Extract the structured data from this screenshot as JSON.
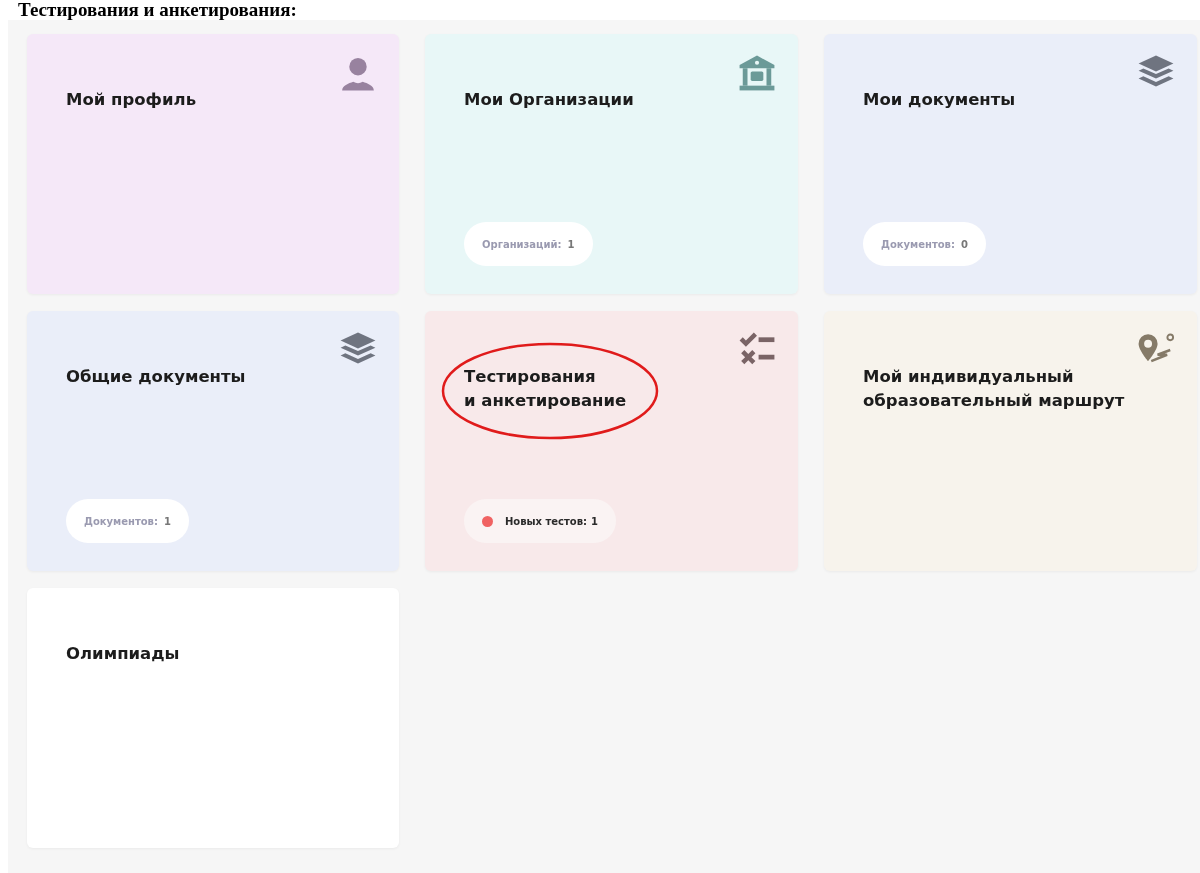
{
  "heading": "Тестирования и анкетирования:",
  "cards": [
    {
      "title": "Мой профиль",
      "color": "#f5e8f8",
      "kind": "person",
      "circled": false
    },
    {
      "title": "Мои Организации",
      "color": "#e8f7f7",
      "kind": "bank",
      "circled": false,
      "badge": {
        "kind": "count",
        "label": "Организаций:",
        "count": "1"
      }
    },
    {
      "title": "Мои документы",
      "color": "#eaeef9",
      "kind": "layers",
      "circled": false,
      "badge": {
        "kind": "count",
        "label": "Документов:",
        "count": "0"
      }
    },
    {
      "title": "Общие документы",
      "color": "#eaeef9",
      "kind": "layers",
      "circled": false,
      "badge": {
        "kind": "count",
        "label": "Документов:",
        "count": "1"
      }
    },
    {
      "title": "Тестирования\nи анкетирование",
      "color": "#f8e9ea",
      "kind": "checklist",
      "circled": true,
      "badge": {
        "kind": "alert",
        "label": "Новых тестов:",
        "count": "1",
        "color": "#f06262"
      }
    },
    {
      "title": "Мой индивидуальный образовательный маршрут",
      "color": "#f7f3ec",
      "kind": "route",
      "circled": false
    },
    {
      "title": "Олимпиады",
      "color": "#ffffff",
      "kind": "plain",
      "circled": false
    }
  ]
}
